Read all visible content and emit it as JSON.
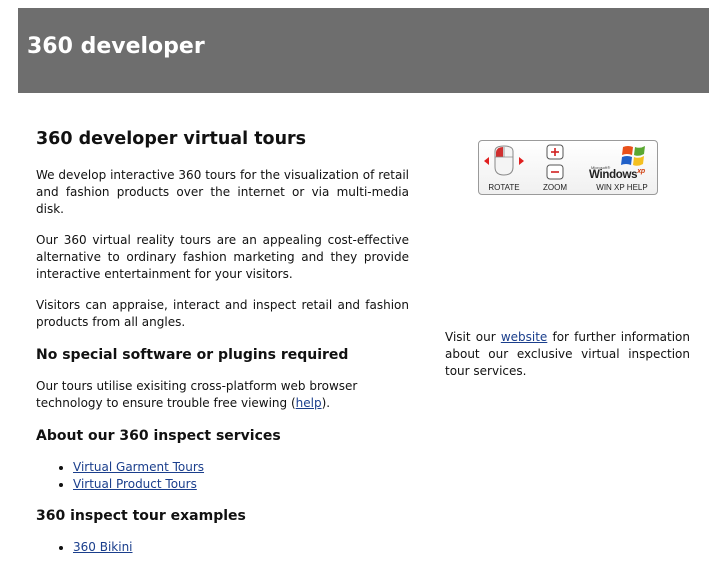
{
  "header": {
    "title": "360 developer"
  },
  "main": {
    "heading": "360 developer virtual tours",
    "intro_paragraphs": [
      "We develop interactive 360 tours for the visualization of retail and fashion products over the internet or via multi-media disk.",
      "Our 360 virtual reality tours are an appealing cost-effective alternative to ordinary fashion marketing and they provide interactive entertainment for your visitors.",
      "Visitors can appraise, interact and inspect retail and fashion products from all angles."
    ],
    "plugins_heading": "No special software or plugins required",
    "plugins_text_before": "Our tours utilise exisiting cross-platform web browser technology to ensure trouble free viewing (",
    "plugins_link": "help",
    "plugins_text_after": ").",
    "services_heading": "About our 360 inspect services",
    "services_links": [
      "Virtual Garment Tours",
      "Virtual Product Tours"
    ],
    "examples_heading": "360 inspect tour examples",
    "examples_links": [
      "360 Bikini"
    ]
  },
  "helpbar": {
    "rotate_label": "ROTATE",
    "zoom_label": "ZOOM",
    "winxp_label": "WIN XP HELP",
    "logo_small": "Microsoft®",
    "logo_word": "Windows",
    "logo_sup": "xp"
  },
  "sidebar": {
    "text_before": "Visit our ",
    "link": "website",
    "text_after": " for further information about our exclusive virtual inspection tour services."
  }
}
